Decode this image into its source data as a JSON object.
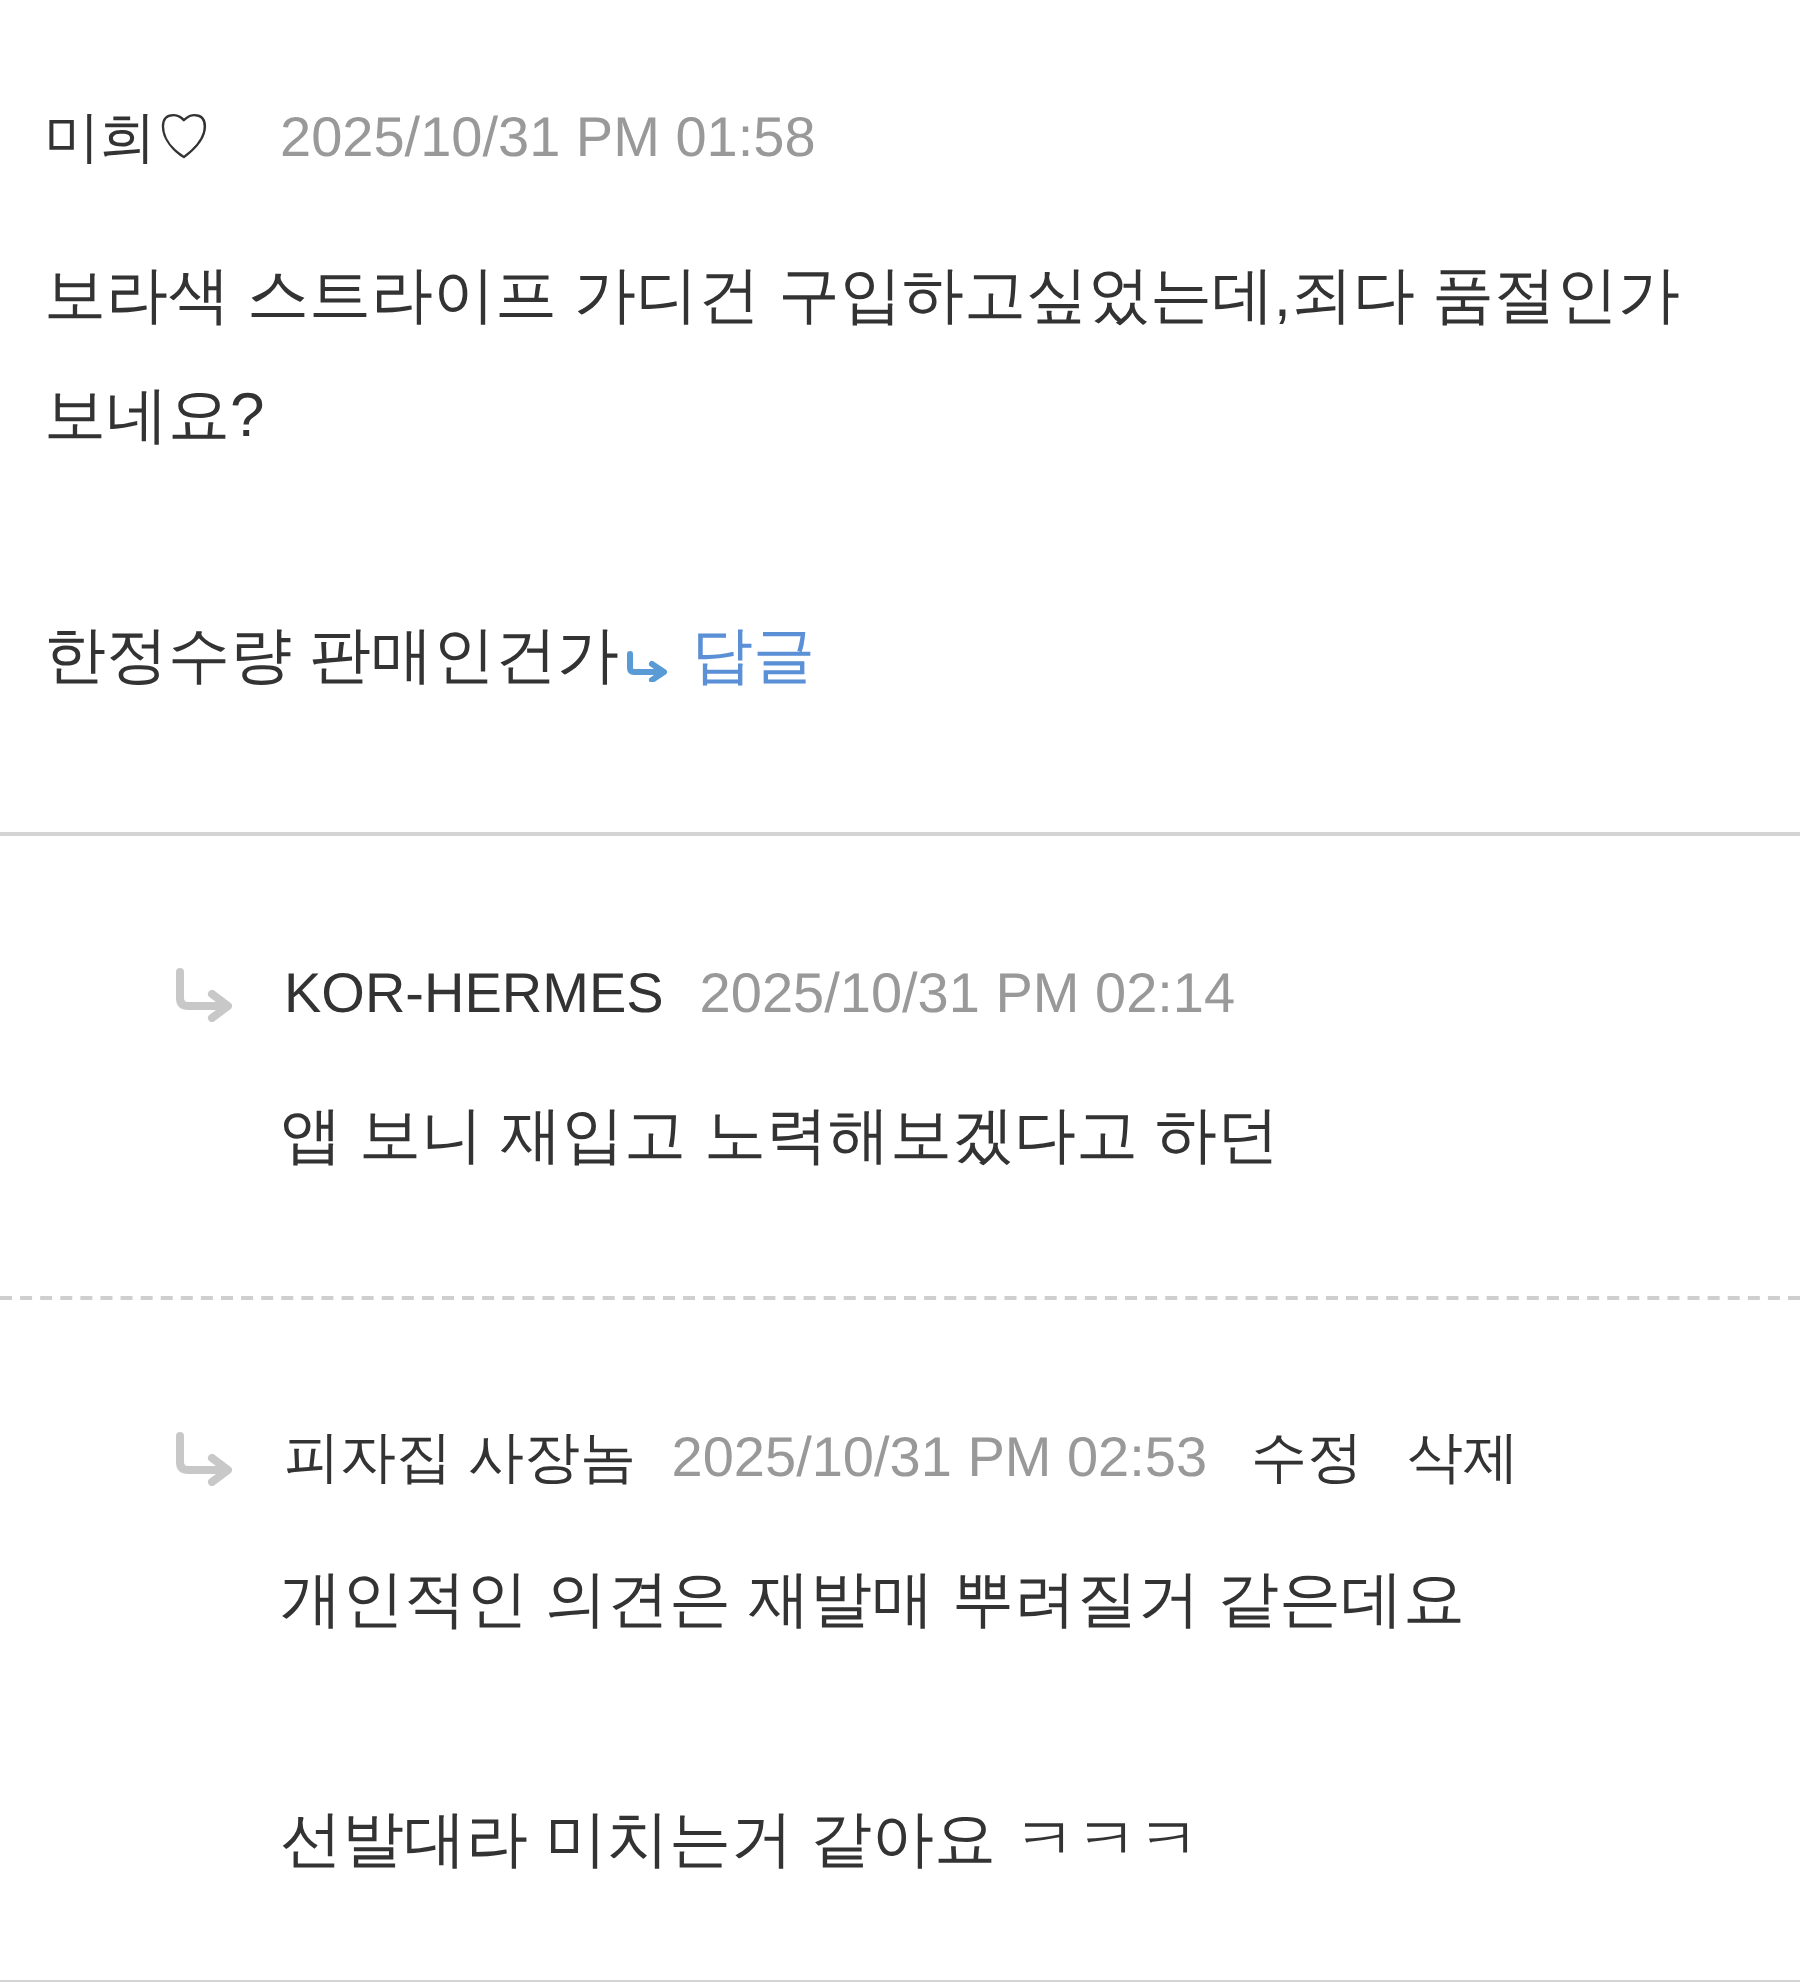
{
  "comment": {
    "author": "미희♡",
    "time": "2025/10/31 PM 01:58",
    "paragraphs": [
      "보라색 스트라이프 가디건 구입하고싶었는데,죄다 품절인가 보네요?",
      "한정수량 판매인건가"
    ],
    "reply_link": "답글"
  },
  "replies": [
    {
      "author": "KOR-HERMES",
      "time": "2025/10/31 PM 02:14",
      "paragraphs": [
        "앱 보니 재입고 노력해보겠다고 하던"
      ]
    },
    {
      "author": "피자집 사장놈",
      "time": "2025/10/31 PM 02:53",
      "actions": [
        "수정",
        "삭제"
      ],
      "paragraphs": [
        "개인적인 의견은 재발매 뿌려질거 같은데요",
        "선발대라 미치는거 같아요 ㅋㅋㅋ"
      ]
    }
  ]
}
